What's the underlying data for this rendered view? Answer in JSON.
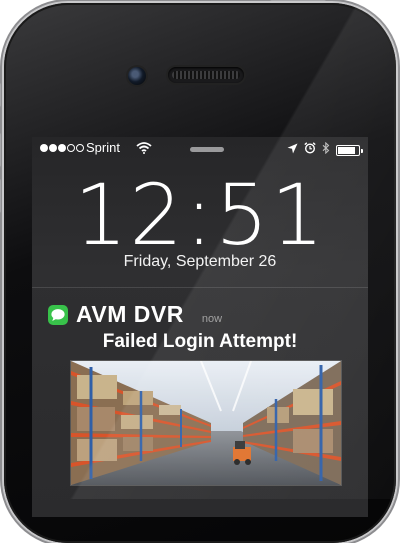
{
  "status_bar": {
    "signal_dots_filled": 3,
    "signal_dots_total": 5,
    "carrier": "Sprint",
    "icons": [
      "wifi-icon",
      "location-arrow-icon",
      "alarm-icon",
      "bluetooth-icon",
      "battery-icon"
    ],
    "battery_level": 0.85
  },
  "lock_screen": {
    "time": "12:51",
    "date": "Friday, September 26"
  },
  "notification": {
    "app_icon": "messages-icon",
    "app_name": "AVM DVR",
    "time": "now",
    "message": "Failed Login Attempt!",
    "attachment_icon": "warehouse-photo"
  },
  "colors": {
    "app_icon": "#38c24a",
    "screen_bg": "#2b2b2d",
    "text": "#ffffff"
  }
}
